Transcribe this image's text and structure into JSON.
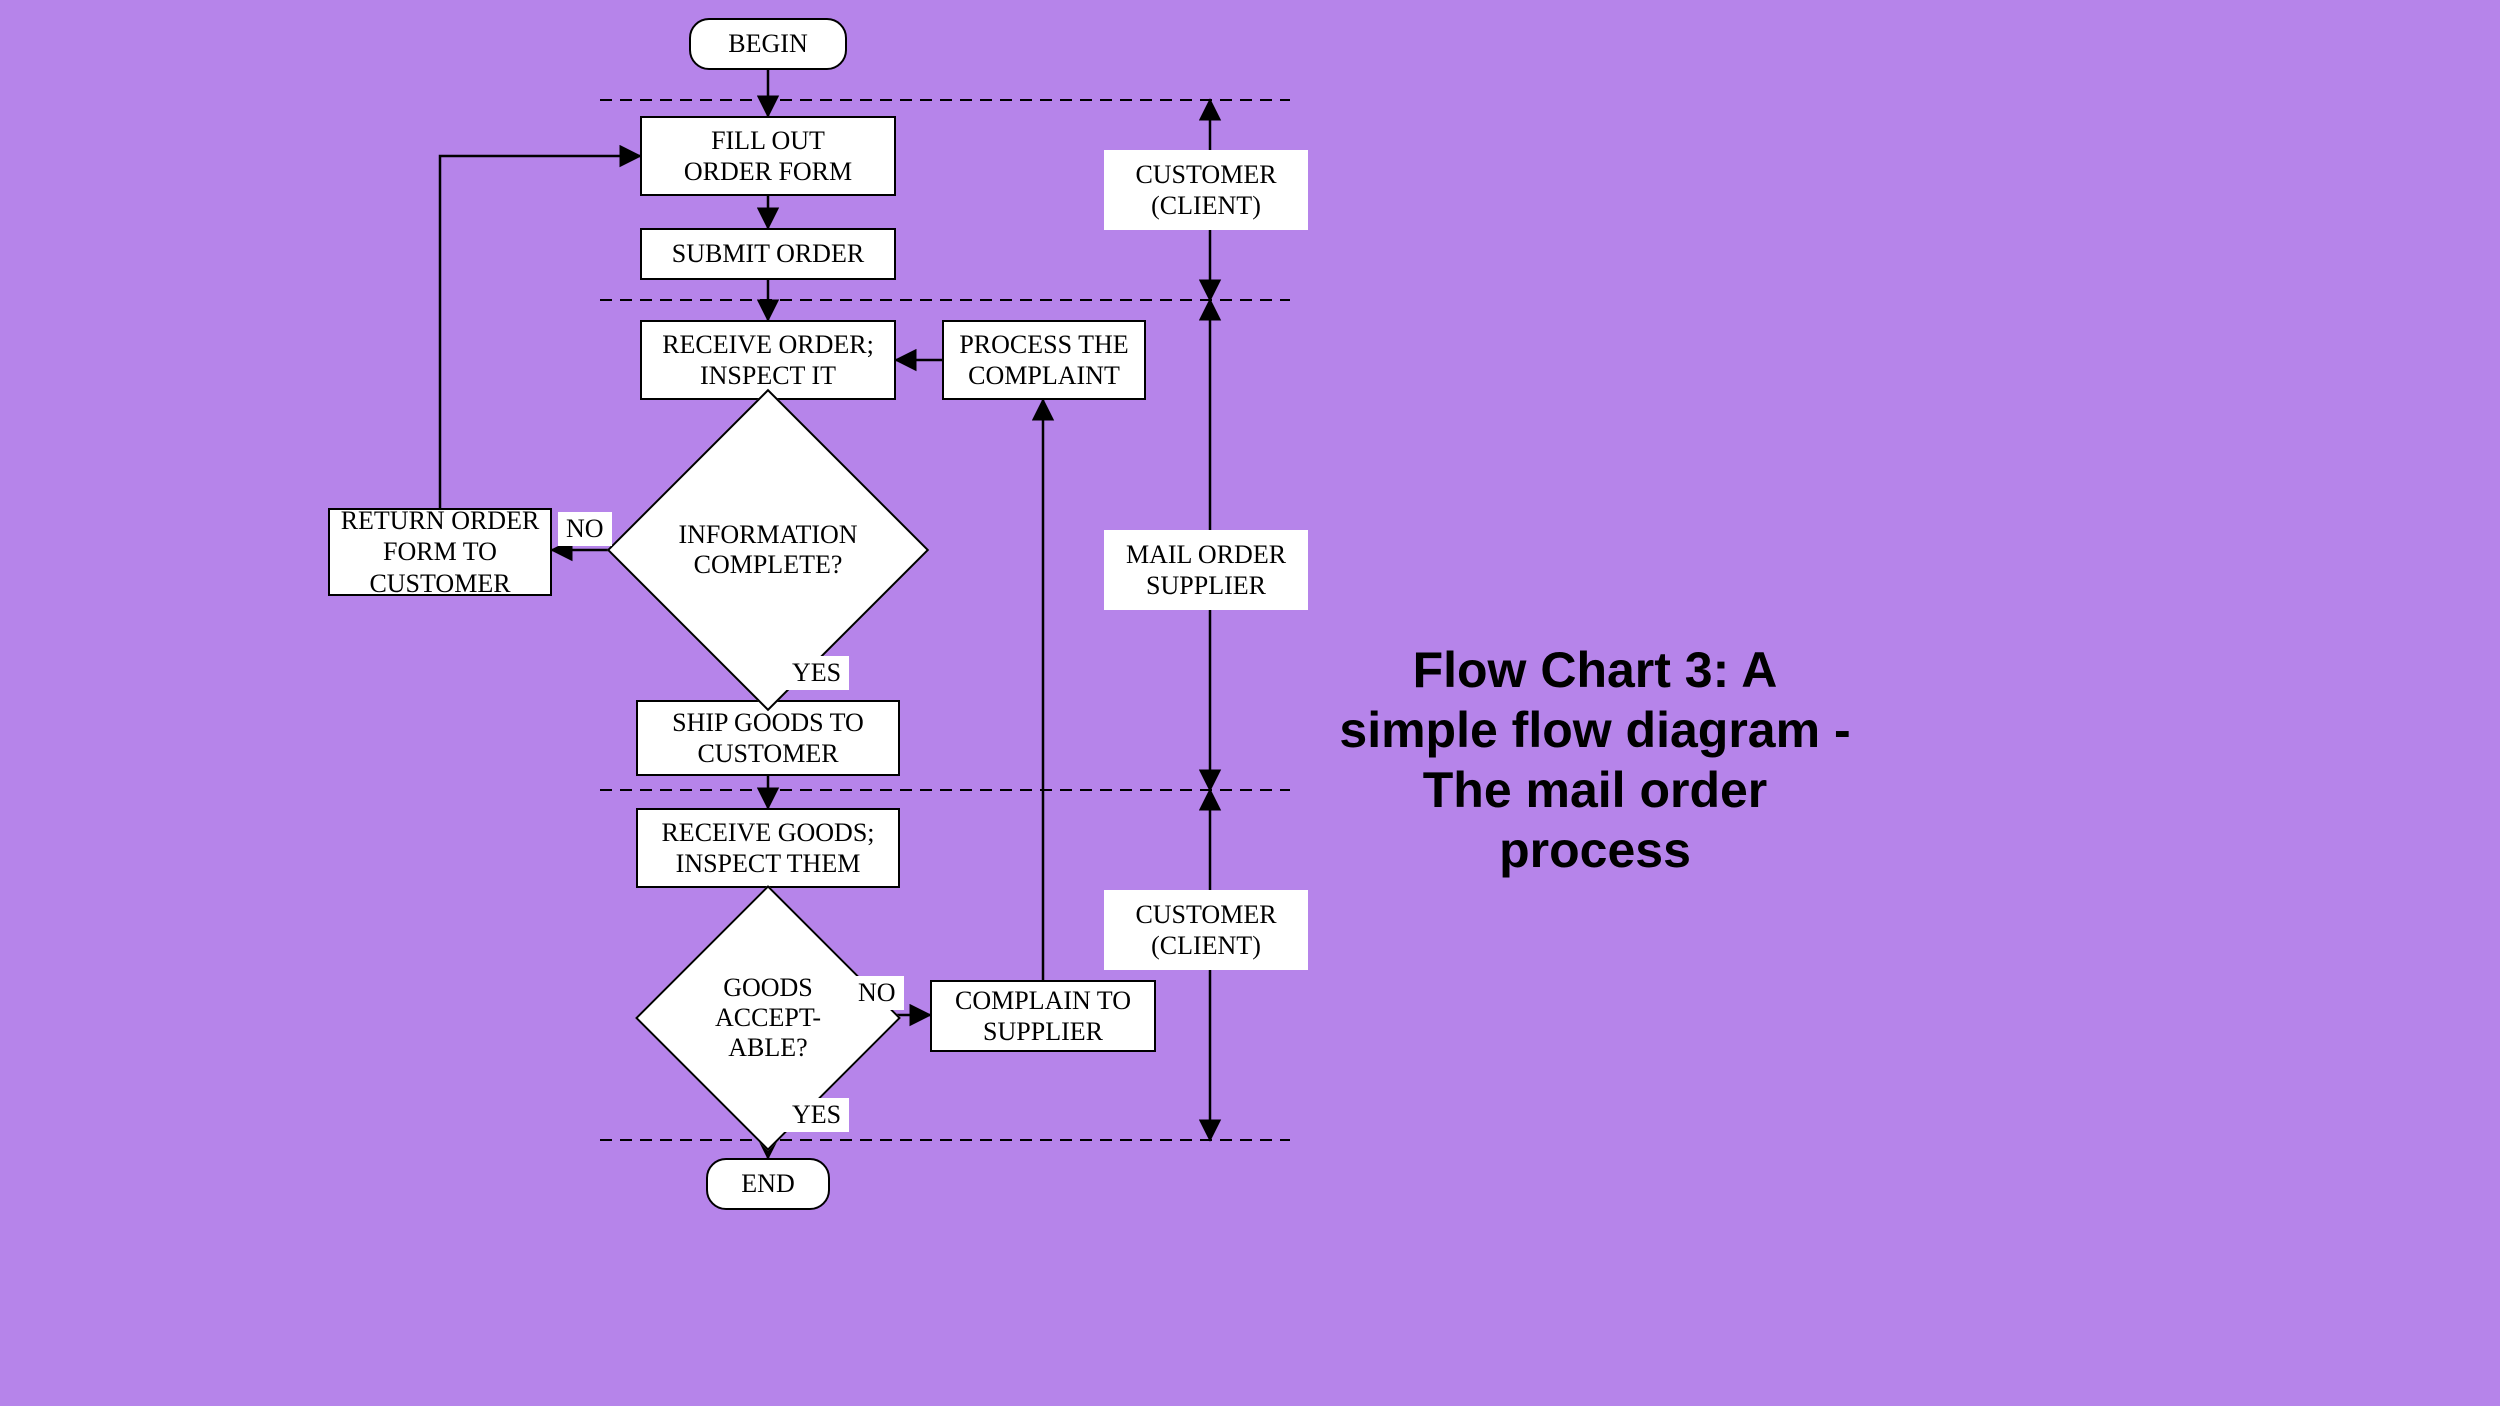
{
  "title": "Flow Chart 3:  A simple flow diagram - The mail order process",
  "nodes": {
    "begin": "BEGIN",
    "fillOut": "FILL OUT\nORDER FORM",
    "submit": "SUBMIT ORDER",
    "receiveOrder": "RECEIVE ORDER;\nINSPECT IT",
    "processComplaint": "PROCESS THE\nCOMPLAINT",
    "infoComplete": "INFORMATION\nCOMPLETE?",
    "returnForm": "RETURN ORDER\nFORM TO\nCUSTOMER",
    "shipGoods": "SHIP GOODS TO\nCUSTOMER",
    "receiveGoods": "RECEIVE GOODS;\nINSPECT THEM",
    "goodsAcceptable": "GOODS\nACCEPT-\nABLE?",
    "complain": "COMPLAIN TO\nSUPPLIER",
    "end": "END"
  },
  "swimlanes": {
    "customerTop": "CUSTOMER\n(CLIENT)",
    "mailOrder": "MAIL ORDER\nSUPPLIER",
    "customerBottom": "CUSTOMER\n(CLIENT)"
  },
  "edgeLabels": {
    "no1": "NO",
    "yes1": "YES",
    "no2": "NO",
    "yes2": "YES"
  }
}
